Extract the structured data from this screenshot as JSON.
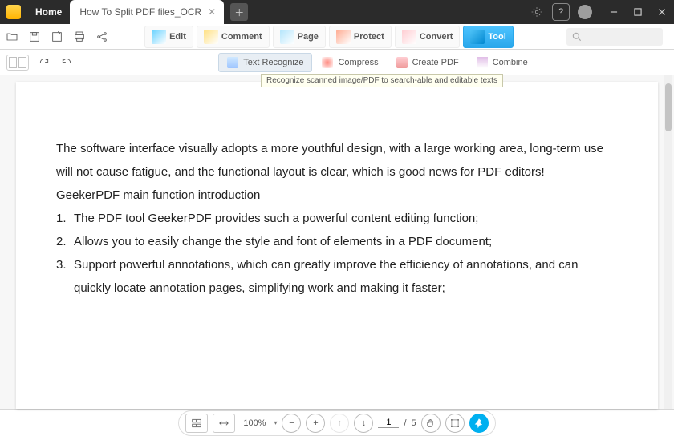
{
  "titlebar": {
    "home_tab": "Home",
    "active_tab": "How To Split PDF files_OCR"
  },
  "ribbon": {
    "edit": "Edit",
    "comment": "Comment",
    "page": "Page",
    "protect": "Protect",
    "convert": "Convert",
    "tool": "Tool"
  },
  "subribbon": {
    "text_recognize": "Text Recognize",
    "compress": "Compress",
    "create_pdf": "Create PDF",
    "combine": "Combine",
    "tooltip": "Recognize scanned image/PDF to search-able and editable texts"
  },
  "document": {
    "para": "The software interface visually adopts a more youthful design, with a large working area, long-term use will not cause fatigue, and the functional layout is clear, which is good news for PDF editors!",
    "heading": "GeekerPDF main function introduction",
    "items": [
      {
        "n": "1.",
        "t": "The PDF tool GeekerPDF provides such a powerful content editing function;"
      },
      {
        "n": "2.",
        "t": "Allows you to easily change the style and font of elements in a PDF document;"
      },
      {
        "n": "3.",
        "t": "Support powerful annotations, which can greatly improve the efficiency of annotations, and can quickly locate annotation pages, simplifying work and making it faster;"
      }
    ]
  },
  "bottombar": {
    "zoom": "100% ",
    "page_current": "1",
    "page_sep": "/",
    "page_total": "5"
  }
}
